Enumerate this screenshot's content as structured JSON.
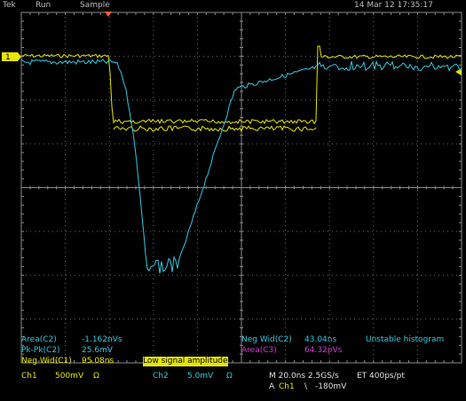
{
  "header": {
    "brand": "Tek",
    "run_state": "Run",
    "acq_mode": "Sample",
    "datetime": "14 Mar 12 17:35:17"
  },
  "markers": {
    "ch1_marker": "1"
  },
  "measurements": {
    "area_c2_label": "Area(C2)",
    "area_c2_value": "-1.162nVs",
    "pkpk_c2_label": "Pk-Pk(C2)",
    "pkpk_c2_value": "25.6mV",
    "negwid_c1_label": "Neg Wid(C1)",
    "negwid_c1_value": "95.08ns",
    "low_signal_note": "Low signal amplitude",
    "negwid_c2_label": "Neg Wid(C2)",
    "negwid_c2_value": "43.04ns",
    "histogram_note": "Unstable histogram",
    "area_c3_label": "Area(C3)",
    "area_c3_value": "64.32pVs"
  },
  "channel_info": {
    "ch1_label": "Ch1",
    "ch1_scale": "500mV",
    "ch1_ohm": "Ω",
    "ch2_label": "Ch2",
    "ch2_scale": "5.0mV",
    "ch2_ohm": "Ω",
    "timebase": "M 20.0ns 2.5GS/s",
    "et_rate": "ET 400ps/pt",
    "trigger_prefix": "A",
    "trigger_source": "Ch1",
    "trigger_slope": "\\",
    "trigger_level": "-180mV"
  },
  "colors": {
    "ch1": "#e6e600",
    "ch2": "#33c8e0",
    "ch3": "#d23cd2",
    "trigger_marker": "#ff5a28"
  }
}
